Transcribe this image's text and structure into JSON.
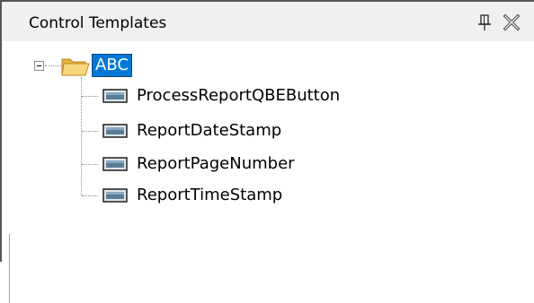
{
  "panel": {
    "title": "Control Templates",
    "pin_icon": "pin-icon",
    "close_icon": "close-icon"
  },
  "tree": {
    "root": {
      "label": "ABC",
      "icon": "open-folder-icon",
      "expanded": true,
      "selected": true
    },
    "children": [
      {
        "label": "ProcessReportQBEButton",
        "icon": "control-template-icon"
      },
      {
        "label": "ReportDateStamp",
        "icon": "control-template-icon"
      },
      {
        "label": "ReportPageNumber",
        "icon": "control-template-icon"
      },
      {
        "label": "ReportTimeStamp",
        "icon": "control-template-icon"
      }
    ]
  },
  "colors": {
    "selection": "#0078d7",
    "titlebar": "#f0f0f0",
    "folder": "#f2c34e",
    "icon_fill": "#5a7d96"
  }
}
